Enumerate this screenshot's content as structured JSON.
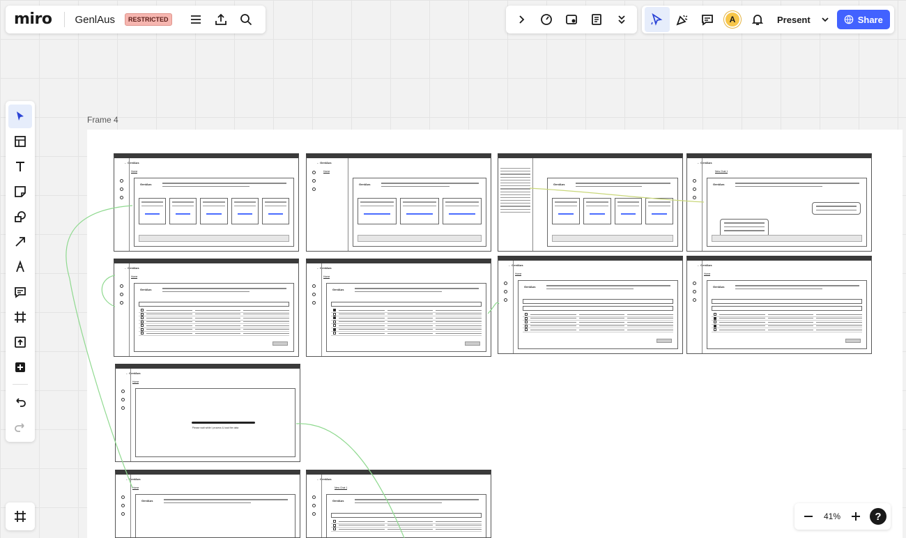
{
  "app": {
    "logo": "miro",
    "board_title": "GenlAus",
    "access_badge": "RESTRICTED"
  },
  "toolbar_right": {
    "present_label": "Present",
    "share_label": "Share",
    "avatar_initial": "A"
  },
  "frame": {
    "label": "Frame 4"
  },
  "wireframes": {
    "brand": "← GenlAus",
    "home_tab": "Home",
    "greeting": "GenlAus",
    "ask_placeholder": "Ask me a question",
    "progress_text": "Please wait while I process & load the data",
    "new_chat_tab": "New Chat 1"
  },
  "zoom": {
    "level": "41%"
  },
  "colors": {
    "accent": "#4262ff",
    "badge_bg": "#f6b6b0",
    "avatar": "#f7c64a",
    "connector": "#9be09b"
  }
}
